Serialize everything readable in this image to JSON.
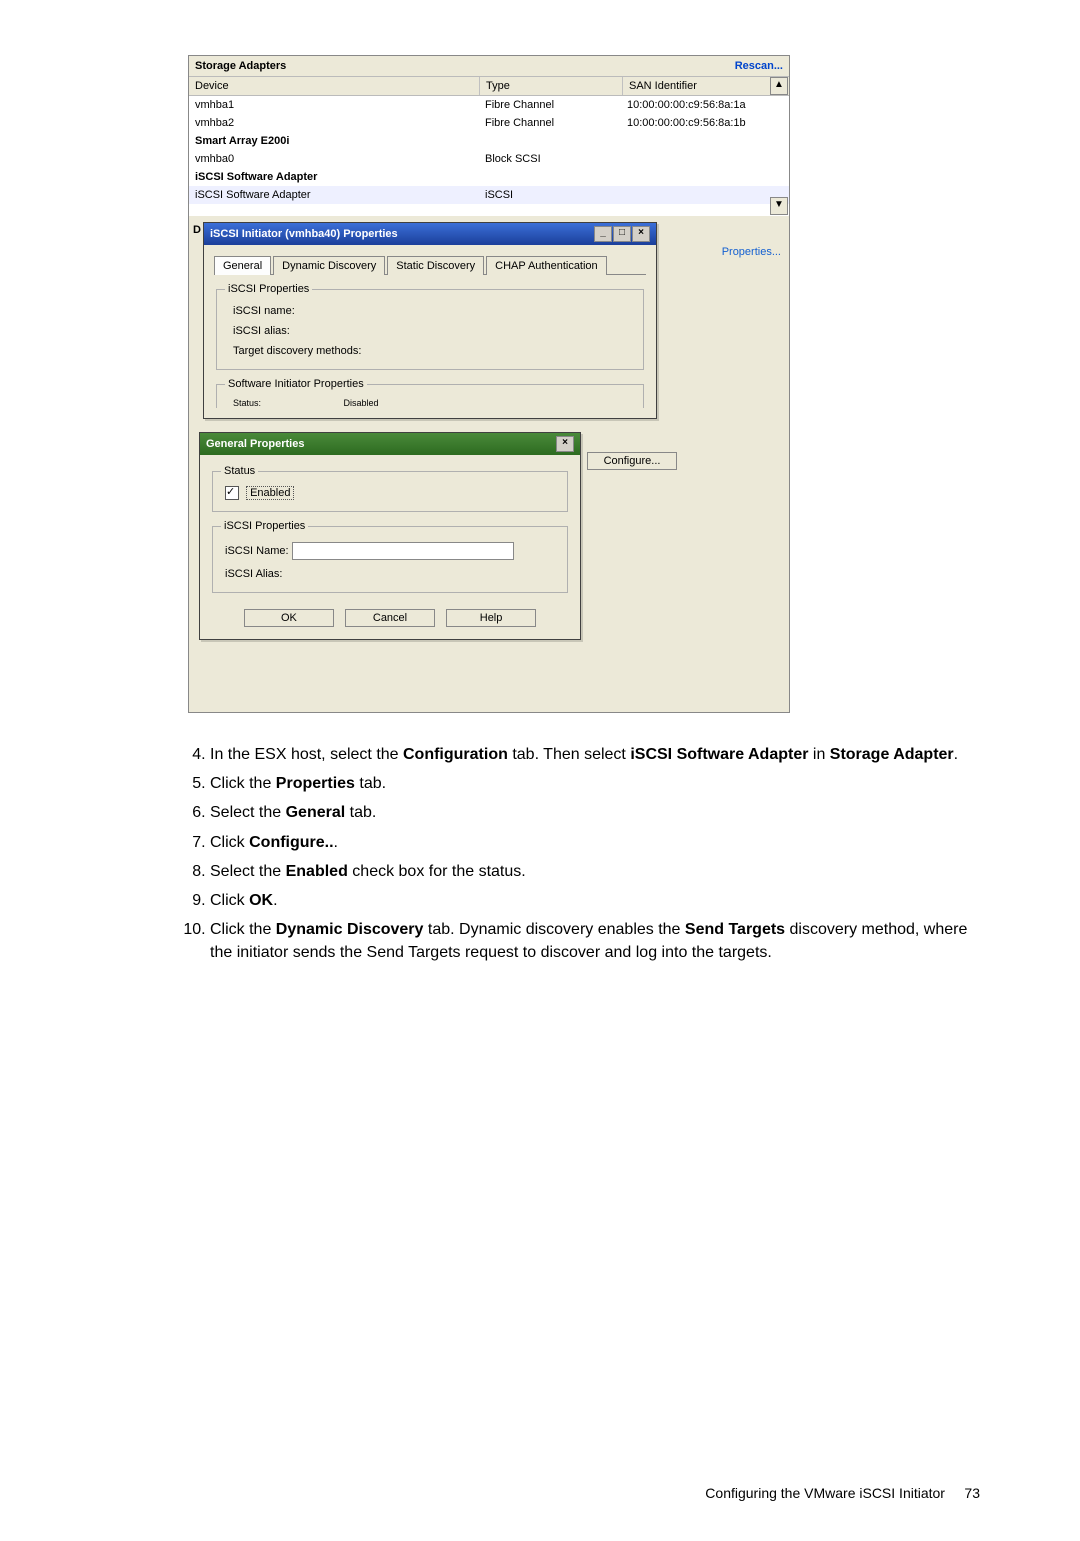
{
  "panel": {
    "title": "Storage Adapters",
    "rescan": "Rescan...",
    "columns": {
      "device": "Device",
      "type": "Type",
      "san": "SAN Identifier"
    },
    "rows": [
      {
        "c1": "vmhba1",
        "c2": "Fibre Channel",
        "c3": "10:00:00:00:c9:56:8a:1a",
        "group": false
      },
      {
        "c1": "vmhba2",
        "c2": "Fibre Channel",
        "c3": "10:00:00:00:c9:56:8a:1b",
        "group": false
      },
      {
        "c1": "Smart Array E200i",
        "c2": "",
        "c3": "",
        "group": true
      },
      {
        "c1": "vmhba0",
        "c2": "Block SCSI",
        "c3": "",
        "group": false
      },
      {
        "c1": "iSCSI Software Adapter",
        "c2": "",
        "c3": "",
        "group": true
      },
      {
        "c1": "iSCSI Software Adapter",
        "c2": "iSCSI",
        "c3": "",
        "group": false,
        "selected": true
      }
    ],
    "d_label": "D",
    "properties_link": "Properties..."
  },
  "dialog1": {
    "title": "iSCSI Initiator (vmhba40) Properties",
    "tabs": [
      "General",
      "Dynamic Discovery",
      "Static Discovery",
      "CHAP Authentication"
    ],
    "fs1_legend": "iSCSI Properties",
    "fs1_l1": "iSCSI name:",
    "fs1_l2": "iSCSI alias:",
    "fs1_l3": "Target discovery methods:",
    "fs2_legend": "Software Initiator Properties",
    "fs2_l1": "Status:",
    "fs2_v1": "Disabled",
    "btn_configure": "Configure..."
  },
  "dialog2": {
    "title": "General Properties",
    "fs1_legend": "Status",
    "fs1_chk": "Enabled",
    "fs2_legend": "iSCSI Properties",
    "fs2_l1": "iSCSI Name:",
    "fs2_l2": "iSCSI Alias:",
    "btn_ok": "OK",
    "btn_cancel": "Cancel",
    "btn_help": "Help"
  },
  "steps": {
    "s4a": "In the ESX host, select the ",
    "s4b": "Configuration",
    "s4c": " tab. Then select ",
    "s4d": "iSCSI Software Adapter",
    "s4e": " in ",
    "s4f": "Storage Adapter",
    "s4g": ".",
    "s5a": "Click the ",
    "s5b": "Properties",
    "s5c": " tab.",
    "s6a": "Select the ",
    "s6b": "General",
    "s6c": " tab.",
    "s7a": "Click ",
    "s7b": "Configure..",
    "s7c": ".",
    "s8a": "Select the ",
    "s8b": "Enabled",
    "s8c": " check box for the status.",
    "s9a": "Click ",
    "s9b": "OK",
    "s9c": ".",
    "s10a": "Click the ",
    "s10b": "Dynamic Discovery",
    "s10c": " tab. Dynamic discovery enables the ",
    "s10d": "Send Targets",
    "s10e": " discovery method, where the initiator sends the Send Targets request to discover and log into the targets."
  },
  "footer_text": "Configuring the VMware iSCSI Initiator",
  "page_num": "73"
}
